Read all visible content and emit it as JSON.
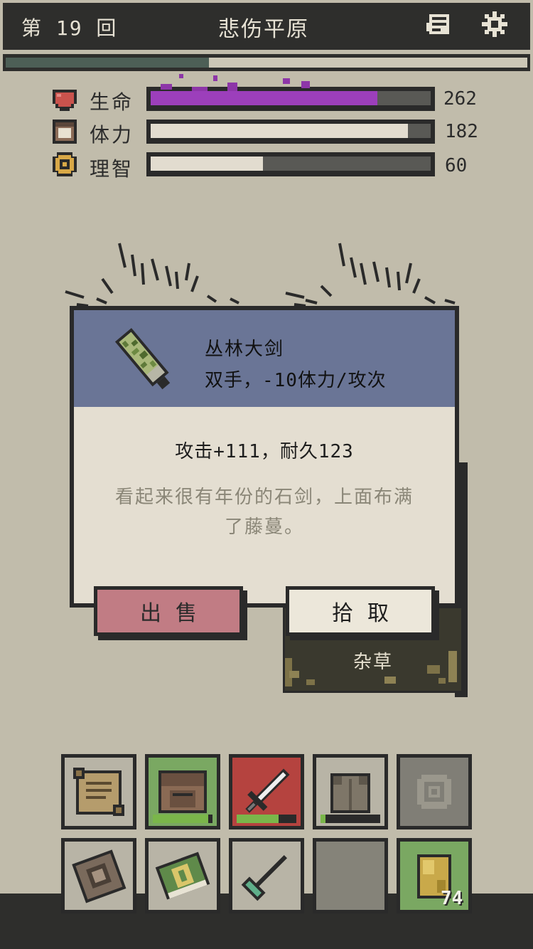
{
  "header": {
    "round_label": "第 19 回",
    "location": "悲伤平原",
    "journal_icon": "journal-icon",
    "settings_icon": "gear-icon"
  },
  "progress": {
    "fraction": 0.39,
    "color": "#4d5f56"
  },
  "stats": [
    {
      "key": "hp",
      "label": "生命",
      "value": "262",
      "fraction": 0.81,
      "color": "#9c3fbb",
      "icon": "heart-icon"
    },
    {
      "key": "stamina",
      "label": "体力",
      "value": "182",
      "fraction": 0.92,
      "color": "#e2dccf",
      "icon": "stamina-icon"
    },
    {
      "key": "sanity",
      "label": "理智",
      "value": "60",
      "fraction": 0.4,
      "color": "#e2dccf",
      "icon": "sanity-icon"
    }
  ],
  "item": {
    "name": "丛林大剑",
    "usage": "双手，-10体力/攻次",
    "stats": "攻击+111，耐久123",
    "flavor": "看起来很有年份的石剑，上面布满了藤蔓。",
    "icon": "jungle-greatsword-icon"
  },
  "actions": {
    "sell": "出售",
    "pickup": "拾取"
  },
  "ground_tile": {
    "label": "杂草"
  },
  "inventory": {
    "row1": [
      {
        "icon": "scroll-icon",
        "bg": "#b8b4a6"
      },
      {
        "icon": "backpack-icon",
        "bg": "#7aa862",
        "durability": 0.93
      },
      {
        "icon": "sword-icon",
        "bg": "#b5433f",
        "durability": 0.7
      },
      {
        "icon": "armor-icon",
        "bg": "#b8b4a6",
        "durability": 0.08
      },
      {
        "icon": "sanity-amulet-icon",
        "bg": "#807e76"
      }
    ],
    "row2": [
      {
        "icon": "spellbook-icon",
        "bg": "#b8b4a6"
      },
      {
        "icon": "cash-bundle-icon",
        "bg": "#b8b4a6"
      },
      {
        "icon": "pickaxe-icon",
        "bg": "#b8b4a6"
      },
      {
        "icon": "empty-slot",
        "bg": "#858379"
      },
      {
        "icon": "gold-pouch-icon",
        "bg": "#7aa862",
        "count": "74"
      }
    ]
  }
}
